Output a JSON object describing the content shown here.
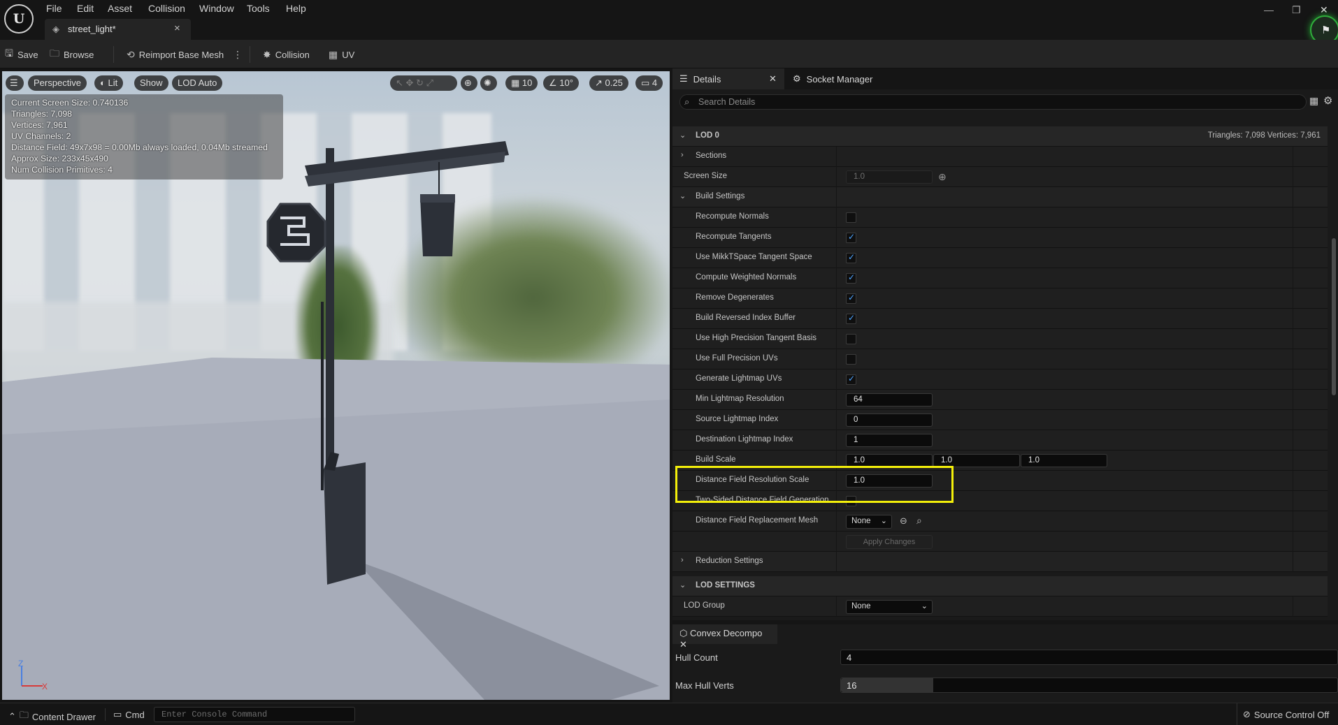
{
  "menu": [
    "File",
    "Edit",
    "Asset",
    "Collision",
    "Window",
    "Tools",
    "Help"
  ],
  "logo_text": "U",
  "tab": {
    "title": "street_light*",
    "close": "×"
  },
  "window_controls": {
    "minimize": "—",
    "restore": "❐",
    "close": "✕"
  },
  "toolbar": {
    "save": "Save",
    "browse": "Browse",
    "reimport": "Reimport Base Mesh",
    "collision": "Collision",
    "uv": "UV"
  },
  "viewport": {
    "perspective": "Perspective",
    "lit": "Lit",
    "show": "Show",
    "lod": "LOD Auto",
    "grid_snap": "10",
    "angle_snap": "10°",
    "scale_snap": "0.25",
    "camera_speed": "4",
    "stats": [
      "Current Screen Size:  0.740136",
      "Triangles:  7,098",
      "Vertices:  7,961",
      "UV Channels:  2",
      "Distance Field:  49x7x98 = 0.00Mb always loaded, 0.04Mb streamed",
      "Approx Size:  233x45x490",
      "Num Collision Primitives:  4"
    ],
    "axis_z": "Z",
    "axis_x": "X"
  },
  "details": {
    "tab_details": "Details",
    "tab_socket": "Socket Manager",
    "search_placeholder": "Search Details",
    "lod0": "LOD 0",
    "lod0_info": "Triangles: 7,098    Vertices: 7,961",
    "sections": "Sections",
    "screen_size": {
      "label": "Screen Size",
      "value": "1.0"
    },
    "build_settings": "Build Settings",
    "checks": [
      {
        "label": "Recompute Normals",
        "checked": false
      },
      {
        "label": "Recompute Tangents",
        "checked": true
      },
      {
        "label": "Use MikkTSpace Tangent Space",
        "checked": true
      },
      {
        "label": "Compute Weighted Normals",
        "checked": true
      },
      {
        "label": "Remove Degenerates",
        "checked": true
      },
      {
        "label": "Build Reversed Index Buffer",
        "checked": true
      },
      {
        "label": "Use High Precision Tangent Basis",
        "checked": false
      },
      {
        "label": "Use Full Precision UVs",
        "checked": false
      },
      {
        "label": "Generate Lightmap UVs",
        "checked": true
      }
    ],
    "min_lightmap": {
      "label": "Min Lightmap Resolution",
      "value": "64"
    },
    "source_lightmap": {
      "label": "Source Lightmap Index",
      "value": "0"
    },
    "dest_lightmap": {
      "label": "Destination Lightmap Index",
      "value": "1"
    },
    "build_scale": {
      "label": "Build Scale",
      "x": "1.0",
      "y": "1.0",
      "z": "1.0"
    },
    "df_res_scale": {
      "label": "Distance Field Resolution Scale",
      "value": "1.0"
    },
    "two_sided": {
      "label": "Two-Sided Distance Field Generation",
      "checked": false
    },
    "df_replacement": {
      "label": "Distance Field Replacement Mesh",
      "value": "None"
    },
    "apply_changes": "Apply Changes",
    "reduction_settings": "Reduction Settings",
    "lod_settings": "LOD SETTINGS",
    "lod_group": {
      "label": "LOD Group",
      "value": "None"
    }
  },
  "convex": {
    "tab": "Convex Decompo",
    "hull_count": {
      "label": "Hull Count",
      "value": "4"
    },
    "max_hull_verts": {
      "label": "Max Hull Verts",
      "value": "16",
      "fill_fraction": 0.186
    }
  },
  "statusbar": {
    "content_drawer": "Content Drawer",
    "cmd": "Cmd",
    "console_placeholder": "Enter Console Command",
    "source_control": "Source Control Off"
  }
}
